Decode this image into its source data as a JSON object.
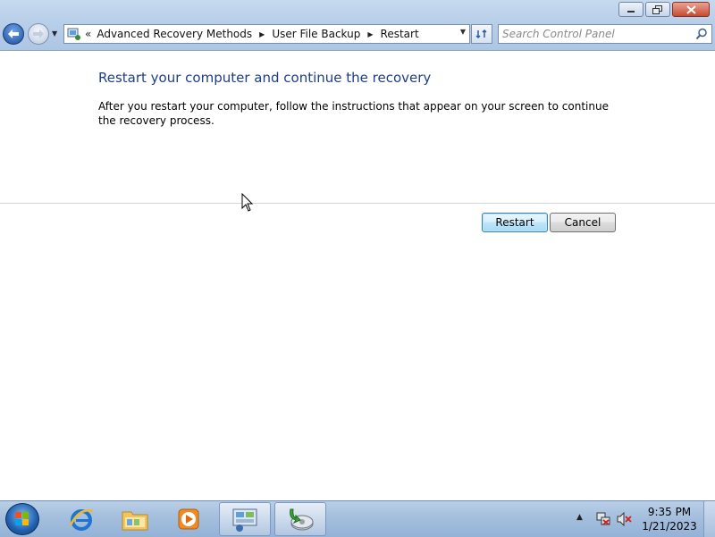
{
  "window": {
    "minimize_icon": "minimize-icon",
    "maximize_icon": "restore-icon",
    "close_icon": "close-icon"
  },
  "navigation": {
    "back_icon": "back-arrow-icon",
    "forward_icon": "forward-arrow-icon",
    "overflow": "«",
    "breadcrumbs": [
      "Advanced Recovery Methods",
      "User File Backup",
      "Restart"
    ],
    "search_placeholder": "Search Control Panel"
  },
  "content": {
    "heading": "Restart your computer and continue the recovery",
    "body": "After you restart your computer, follow the instructions that appear on your screen to continue the recovery process.",
    "restart_label": "Restart",
    "cancel_label": "Cancel"
  },
  "taskbar": {
    "items": [
      "start-orb",
      "internet-explorer-icon",
      "windows-explorer-icon",
      "media-player-icon",
      "control-panel-icon",
      "backup-restore-icon"
    ],
    "time": "9:35 PM",
    "date": "1/21/2023"
  },
  "colors": {
    "heading": "#1e3f87",
    "titlebar": "#b8cfe9",
    "taskbar": "#a6c0de"
  }
}
